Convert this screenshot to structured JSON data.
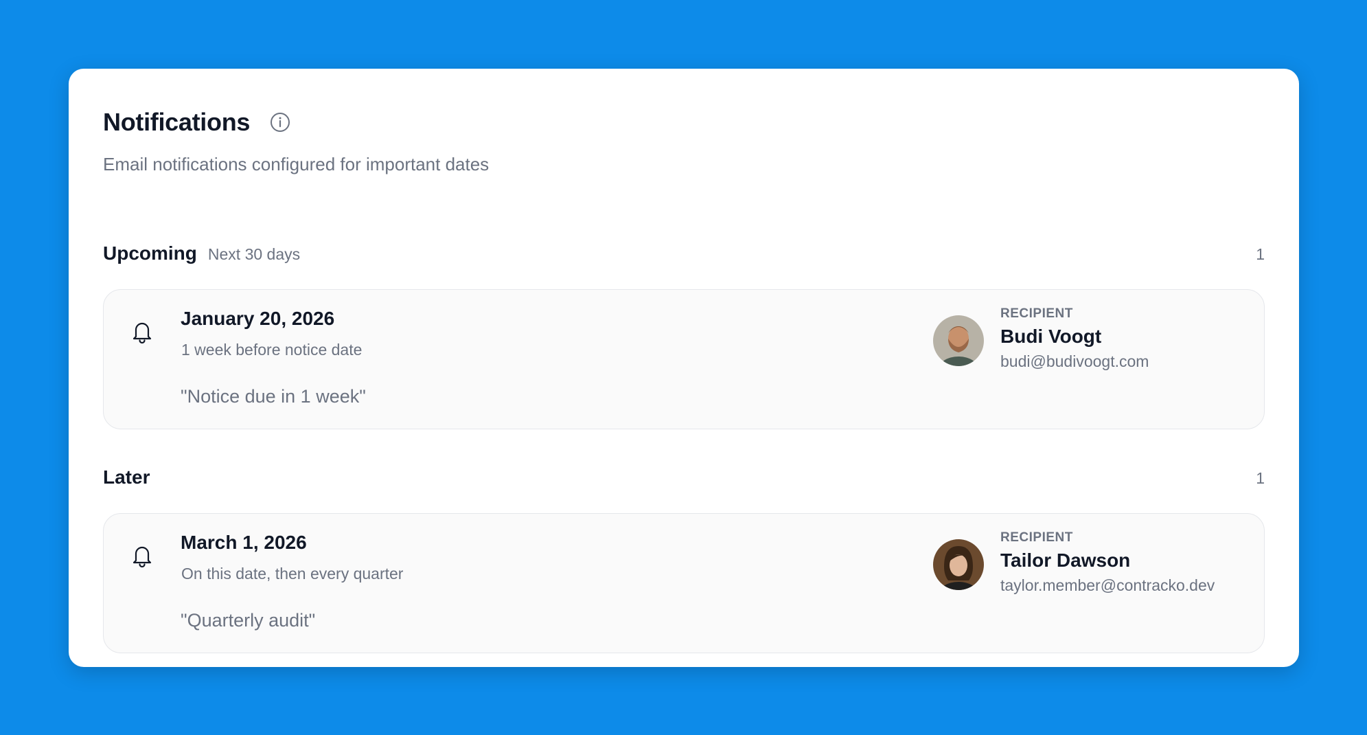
{
  "header": {
    "title": "Notifications",
    "info_icon": "info-circle-icon",
    "subtitle": "Email notifications configured for important dates"
  },
  "sections": [
    {
      "title": "Upcoming",
      "subtitle": "Next 30 days",
      "count": "1",
      "items": [
        {
          "icon": "bell-icon",
          "date": "January 20, 2026",
          "rule": "1 week before notice date",
          "message": "\"Notice due in 1 week\"",
          "recipient_label": "RECIPIENT",
          "recipient_name": "Budi Voogt",
          "recipient_email": "budi@budivoogt.com"
        }
      ]
    },
    {
      "title": "Later",
      "subtitle": "",
      "count": "1",
      "items": [
        {
          "icon": "bell-icon",
          "date": "March 1, 2026",
          "rule": "On this date, then every quarter",
          "message": "\"Quarterly audit\"",
          "recipient_label": "RECIPIENT",
          "recipient_name": "Tailor Dawson",
          "recipient_email": "taylor.member@contracko.dev"
        }
      ]
    }
  ],
  "colors": {
    "background": "#0d8be9",
    "panel": "#ffffff",
    "card": "#fafafa",
    "text_primary": "#111827",
    "text_muted": "#6b7280"
  }
}
